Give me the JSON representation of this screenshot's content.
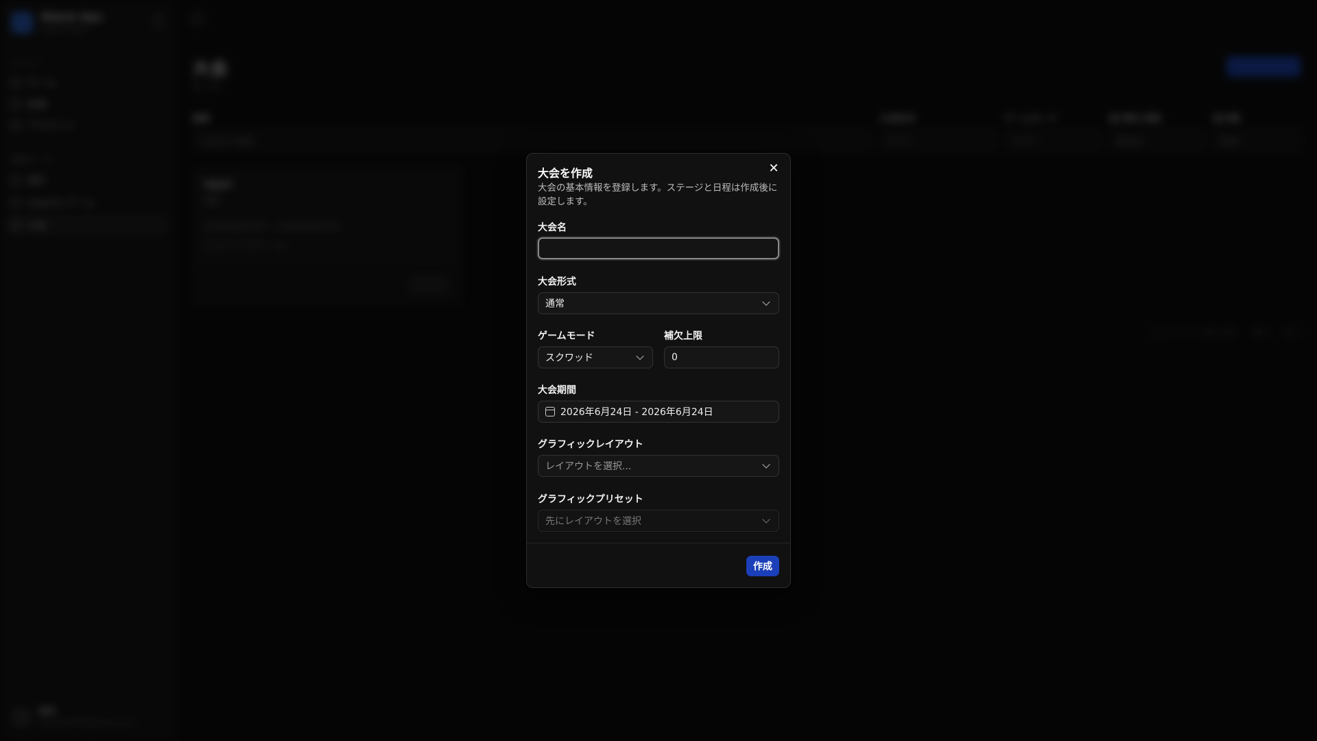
{
  "background": {
    "app": {
      "name": "Match Ops",
      "subtitle": "Admin Panel"
    },
    "sidebar": {
      "section_menu": "メニュー",
      "menu_items": [
        "ホーム",
        "投稿",
        "アカウント"
      ],
      "section_master": "基礎データ",
      "master_items": [
        "選手",
        "esports ゲーム",
        "大会"
      ]
    },
    "user": {
      "name": "WO",
      "email": "matchu0707@icloud.com"
    },
    "page": {
      "title": "大会",
      "count": "全 1 件",
      "create_button": "大会を作成"
    },
    "filters": [
      {
        "label": "検索",
        "value": "大会名で検索"
      },
      {
        "label": "大会形式",
        "value": "すべて"
      },
      {
        "label": "ゲームモード",
        "value": "すべて"
      },
      {
        "label": "並び替え項目",
        "value": "登録日"
      },
      {
        "label": "並び順",
        "value": "降順"
      }
    ],
    "card": {
      "title": "TEST",
      "subtitle": "通常",
      "period": "2026年6月24日 〜 2026年6月24日",
      "meta": "デュオ / 3 スター: 1人",
      "detail_button": "詳細"
    },
    "pager": {
      "info": "1 / 1 ページ（全 1 件）",
      "prev": "前へ",
      "next": "次へ"
    }
  },
  "dialog": {
    "title": "大会を作成",
    "description": "大会の基本情報を登録します。ステージと日程は作成後に設定します。",
    "fields": {
      "name": {
        "label": "大会名",
        "value": "",
        "placeholder": ""
      },
      "format": {
        "label": "大会形式",
        "value": "通常"
      },
      "game_mode": {
        "label": "ゲームモード",
        "value": "スクワッド"
      },
      "substitute_limit": {
        "label": "補欠上限",
        "value": "0"
      },
      "period": {
        "label": "大会期間",
        "value": "2026年6月24日 - 2026年6月24日"
      },
      "graphic_layout": {
        "label": "グラフィックレイアウト",
        "placeholder": "レイアウトを選択..."
      },
      "graphic_preset": {
        "label": "グラフィックプリセット",
        "placeholder": "先にレイアウトを選択"
      }
    },
    "submit_label": "作成",
    "close_symbol": "✕"
  }
}
